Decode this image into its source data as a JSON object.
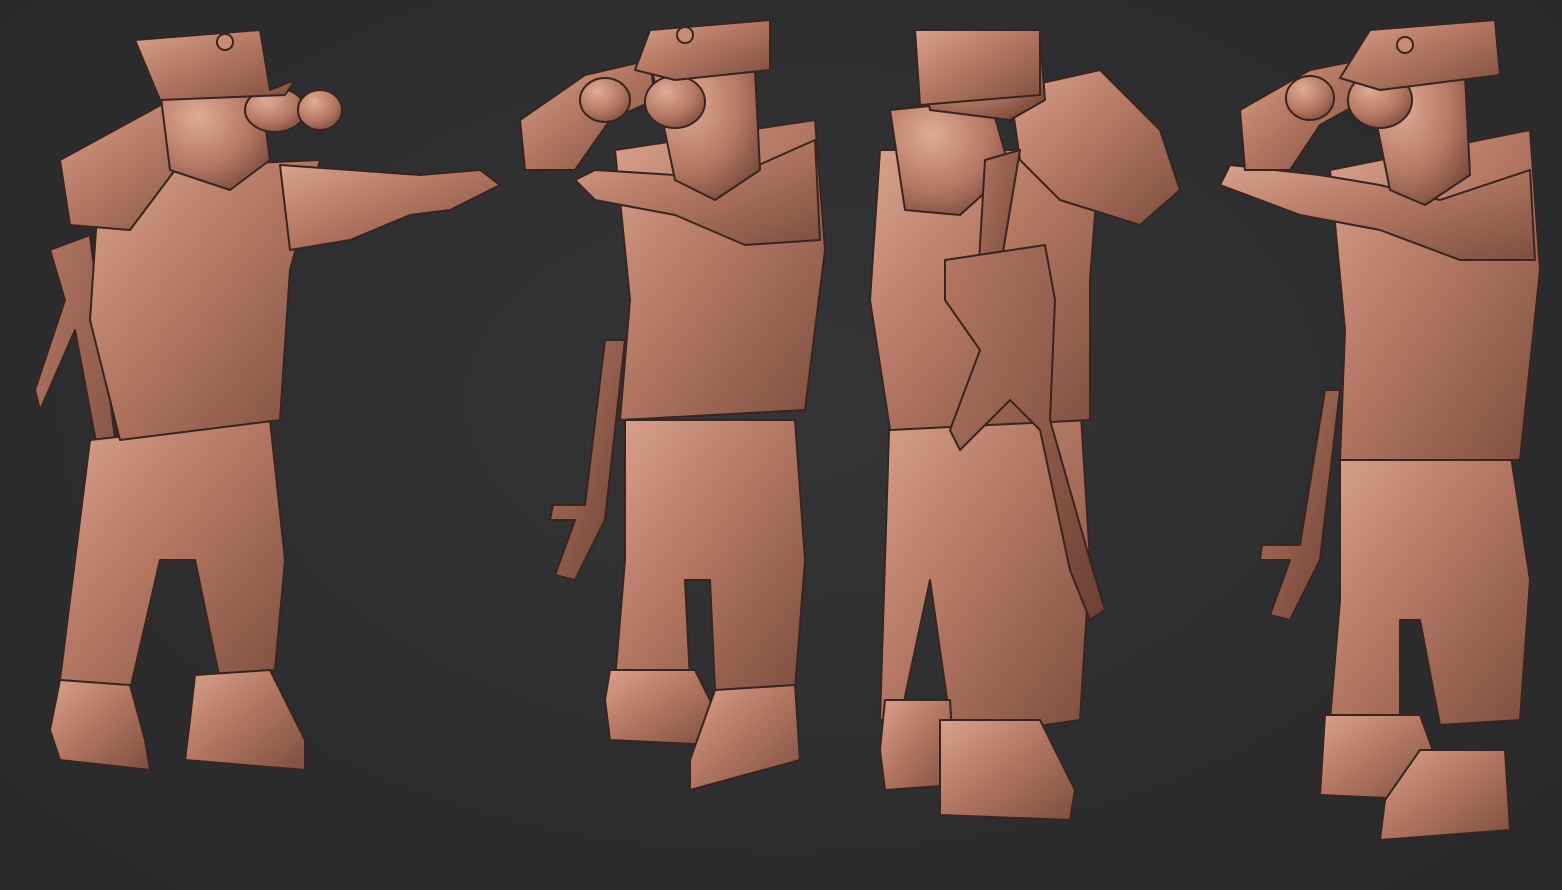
{
  "scene": {
    "background_color": "#2e2e30",
    "material_color": "#b47864",
    "material_shadow": "#7e4e3f",
    "material_highlight": "#d9a28c",
    "outline_color": "#3a2420"
  },
  "figures": [
    {
      "view": "front-left"
    },
    {
      "view": "front"
    },
    {
      "view": "back"
    },
    {
      "view": "front-right"
    }
  ]
}
